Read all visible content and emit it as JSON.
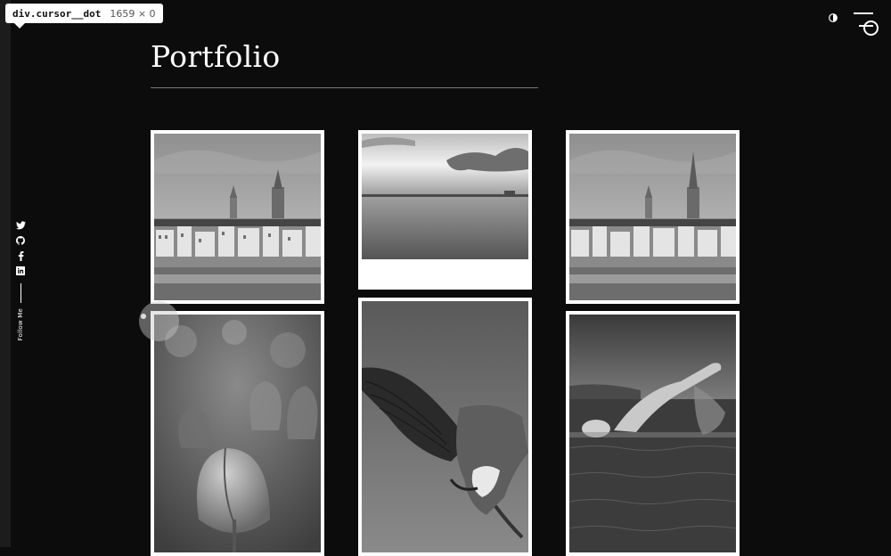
{
  "inspector": {
    "selector": "div.cursor__dot",
    "dimensions": "1659 × 0"
  },
  "page": {
    "title": "Portfolio"
  },
  "sidebar": {
    "icons": [
      "twitter-icon",
      "github-icon",
      "facebook-icon",
      "linkedin-icon"
    ],
    "follow_label": "Follow Me"
  },
  "header": {
    "icons": [
      "theme-toggle-icon",
      "menu-icon"
    ]
  },
  "gallery": {
    "items": [
      {
        "subject": "city-skyline"
      },
      {
        "subject": "sea-horizon"
      },
      {
        "subject": "city-skyline"
      },
      {
        "subject": "tulips"
      },
      {
        "subject": "eagle"
      },
      {
        "subject": "swimmer"
      }
    ]
  }
}
